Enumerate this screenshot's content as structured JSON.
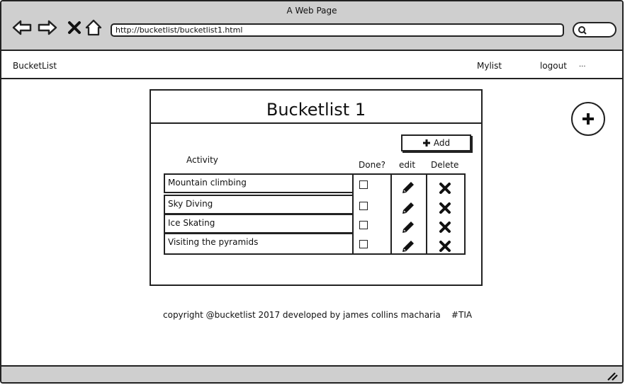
{
  "window": {
    "title": "A Web Page",
    "url": "http://bucketlist/bucketlist1.html"
  },
  "menu": {
    "brand": "BucketList",
    "mylist": "Mylist",
    "logout": "logout",
    "more": "..."
  },
  "panel": {
    "title": "Bucketlist 1",
    "add_label": "Add",
    "headers": {
      "activity": "Activity",
      "done": "Done?",
      "edit": "edit",
      "delete": "Delete"
    },
    "rows": [
      {
        "activity": "Mountain climbing"
      },
      {
        "activity": "Sky Diving"
      },
      {
        "activity": "Ice Skating"
      },
      {
        "activity": "Visiting the pyramids"
      }
    ]
  },
  "footer": {
    "text": "copyright @bucketlist 2017 developed by james collins macharia    #TIA"
  },
  "icons": [
    "back-arrow-icon",
    "forward-arrow-icon",
    "close-icon",
    "home-icon",
    "search-icon",
    "plus-icon",
    "pencil-icon",
    "delete-x-icon",
    "resize-grip-icon"
  ]
}
